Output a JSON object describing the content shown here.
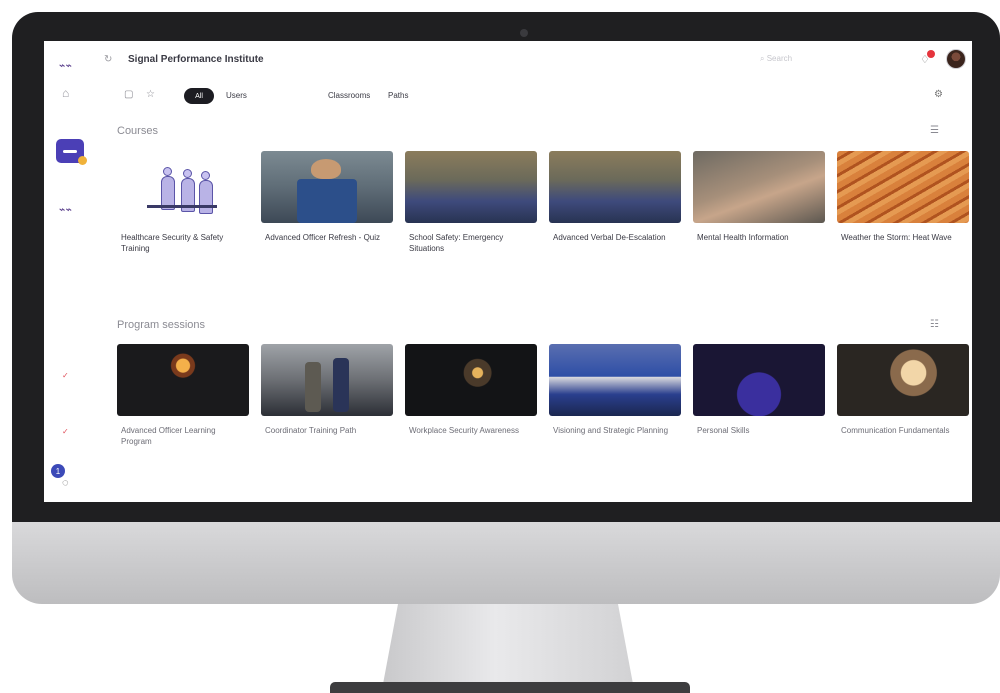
{
  "app": {
    "title": "Signal Performance Institute",
    "search_placeholder": "Search"
  },
  "filters": {
    "active_chip": "All",
    "tabs": [
      "Users",
      "Classrooms",
      "Paths"
    ]
  },
  "courses": {
    "title": "Courses",
    "items": [
      {
        "title": "Healthcare Security & Safety Training",
        "thumb": "illustration"
      },
      {
        "title": "Advanced Officer Refresh - Quiz",
        "thumb": "officer-photo"
      },
      {
        "title": "School Safety: Emergency Situations",
        "thumb": "car-reflection"
      },
      {
        "title": "Advanced Verbal De-Escalation",
        "thumb": "car-reflection"
      },
      {
        "title": "Mental Health Information",
        "thumb": "hands"
      },
      {
        "title": "Weather the Storm: Heat Wave",
        "thumb": "sand"
      }
    ]
  },
  "program_sessions": {
    "title": "Program sessions",
    "items": [
      {
        "title": "Advanced Officer Learning Program",
        "thumb": "night-lights"
      },
      {
        "title": "Coordinator Training Path",
        "thumb": "parking-officers"
      },
      {
        "title": "Workplace Security Awareness",
        "thumb": "night-street"
      },
      {
        "title": "Visioning and Strategic Planning",
        "thumb": "police-car"
      },
      {
        "title": "Personal Skills",
        "thumb": "security-jacket"
      },
      {
        "title": "Communication Fundamentals",
        "thumb": "woman-window"
      }
    ]
  },
  "sidebar": {
    "badge_count": "1"
  },
  "colors": {
    "accent": "#4b3fb6",
    "notification": "#e5343c",
    "chip_bg": "#1c1c22"
  }
}
